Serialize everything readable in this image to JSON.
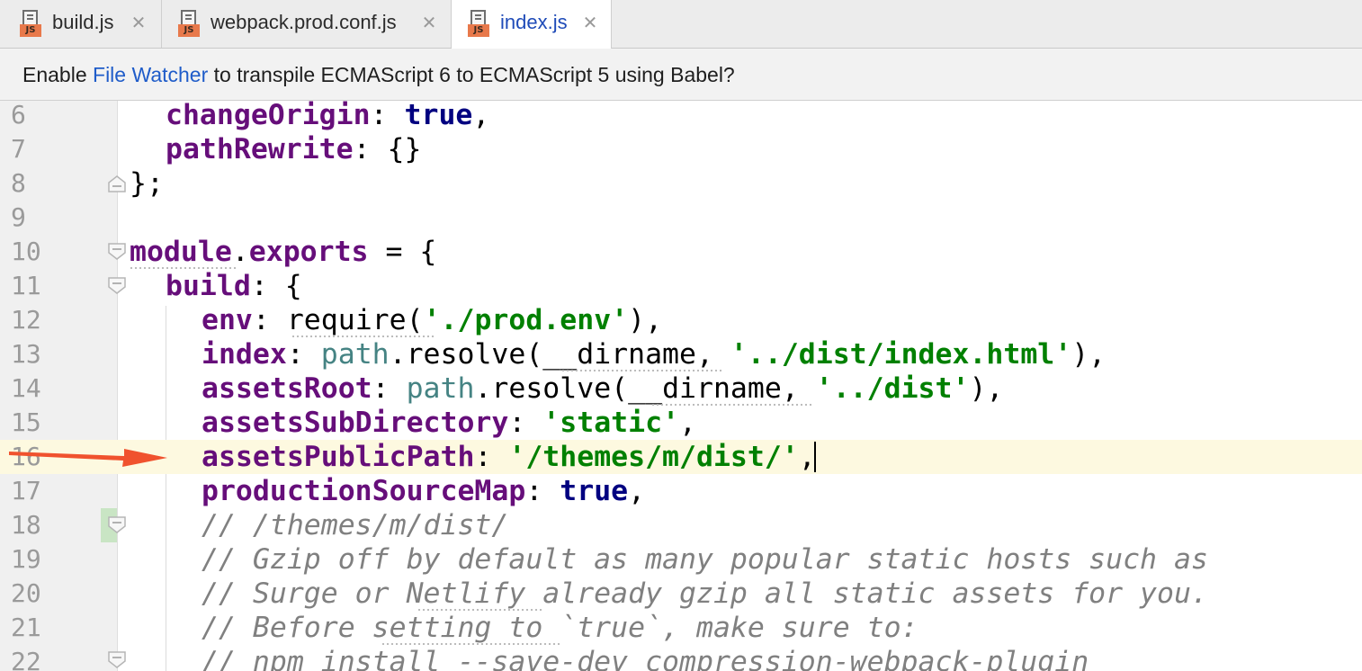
{
  "tabs": [
    {
      "label": "build.js",
      "icon": "js-file-icon",
      "icon_badge": "JS",
      "active": false
    },
    {
      "label": "webpack.prod.conf.js",
      "icon": "js-file-icon",
      "icon_badge": "JS",
      "active": false
    },
    {
      "label": "index.js",
      "icon": "js-file-icon",
      "icon_badge": "JS",
      "active": true
    }
  ],
  "notification": {
    "prefix": "Enable ",
    "link": "File Watcher",
    "suffix": " to transpile ECMAScript 6 to ECMAScript 5 using Babel?"
  },
  "editor": {
    "current_line": "16",
    "lines": [
      {
        "num": "6"
      },
      {
        "num": "7"
      },
      {
        "num": "8"
      },
      {
        "num": "9"
      },
      {
        "num": "10"
      },
      {
        "num": "11"
      },
      {
        "num": "12"
      },
      {
        "num": "13"
      },
      {
        "num": "14"
      },
      {
        "num": "15"
      },
      {
        "num": "16"
      },
      {
        "num": "17"
      },
      {
        "num": "18"
      },
      {
        "num": "19"
      },
      {
        "num": "20"
      },
      {
        "num": "21"
      },
      {
        "num": "22"
      }
    ],
    "code": {
      "l6": {
        "key": "changeOrigin",
        "colon": ": ",
        "value": "true",
        "end": ","
      },
      "l7": {
        "key": "pathRewrite",
        "rest": ": {}"
      },
      "l8": {
        "text": "};"
      },
      "l10": {
        "obj": "module",
        "dot": ".",
        "prop": "exports",
        "rest": " = {"
      },
      "l11": {
        "key": "build",
        "rest": ": {"
      },
      "l12": {
        "key": "env",
        "colon": ": ",
        "fn": "require",
        "open": "(",
        "str": "'./prod.env'",
        "close": "),"
      },
      "l13": {
        "key": "index",
        "colon": ": ",
        "obj": "path",
        "call": ".resolve(__dirname, ",
        "str": "'../dist/index.html'",
        "close": "),"
      },
      "l14": {
        "key": "assetsRoot",
        "colon": ": ",
        "obj": "path",
        "call": ".resolve(__dirname, ",
        "str": "'../dist'",
        "close": "),"
      },
      "l15": {
        "key": "assetsSubDirectory",
        "colon": ": ",
        "str": "'static'",
        "close": ","
      },
      "l16": {
        "key": "assetsPublicPath",
        "colon": ": ",
        "str_a": "'/themes/m/dist/",
        "str_b": "'",
        "close": ","
      },
      "l17": {
        "key": "productionSourceMap",
        "colon": ": ",
        "value": "true",
        "end": ","
      },
      "l18": {
        "comment": "// /themes/m/dist/"
      },
      "l19": {
        "comment": "// Gzip off by default as many popular static hosts such as"
      },
      "l20": {
        "comment": "// Surge or Netlify already gzip all static assets for you."
      },
      "l21": {
        "comment": "// Before setting to `true`, make sure to:"
      },
      "l22": {
        "comment": "// npm install --save-dev compression-webpack-plugin"
      }
    }
  },
  "annotation": {
    "arrow_color": "#f0522e",
    "target_line": "16"
  },
  "colors": {
    "property": "#660e7a",
    "keyword": "#000080",
    "string": "#008000",
    "comment": "#808080",
    "identifier": "#458383",
    "current_line_bg": "#fdf9e0"
  }
}
